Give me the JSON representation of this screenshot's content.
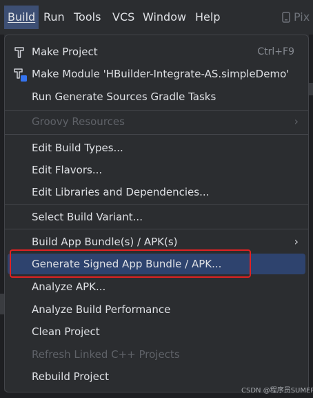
{
  "menubar": {
    "items": [
      {
        "label": "Build"
      },
      {
        "label": "Run"
      },
      {
        "label": "Tools"
      },
      {
        "label": "VCS"
      },
      {
        "label": "Window"
      },
      {
        "label": "Help"
      }
    ],
    "right_label": "Pix"
  },
  "build_menu": {
    "make_project": {
      "label": "Make Project",
      "shortcut": "Ctrl+F9",
      "icon": "hammer-icon"
    },
    "make_module": {
      "label": "Make Module 'HBuilder-Integrate-AS.simpleDemo'",
      "icon": "module-hammer-icon"
    },
    "run_generate": {
      "label": "Run Generate Sources Gradle Tasks"
    },
    "groovy_resources": {
      "label": "Groovy Resources",
      "enabled": false
    },
    "edit_build_types": {
      "label": "Edit Build Types..."
    },
    "edit_flavors": {
      "label": "Edit Flavors..."
    },
    "edit_libraries": {
      "label": "Edit Libraries and Dependencies..."
    },
    "select_variant": {
      "label": "Select Build Variant..."
    },
    "build_bundle": {
      "label": "Build App Bundle(s) / APK(s)"
    },
    "generate_signed": {
      "label": "Generate Signed App Bundle / APK...",
      "selected": true
    },
    "analyze_apk": {
      "label": "Analyze APK..."
    },
    "analyze_performance": {
      "label": "Analyze Build Performance"
    },
    "clean_project": {
      "label": "Clean Project"
    },
    "refresh_cpp": {
      "label": "Refresh Linked C++ Projects",
      "enabled": false
    },
    "rebuild_project": {
      "label": "Rebuild Project"
    }
  },
  "watermark": "CSDN @程序员SUMER",
  "colors": {
    "background": "#2b2d30",
    "selection": "#2e436e",
    "active_menu": "#3d4f74",
    "annotation_red": "#e02222",
    "disabled_text": "#5f6268"
  }
}
